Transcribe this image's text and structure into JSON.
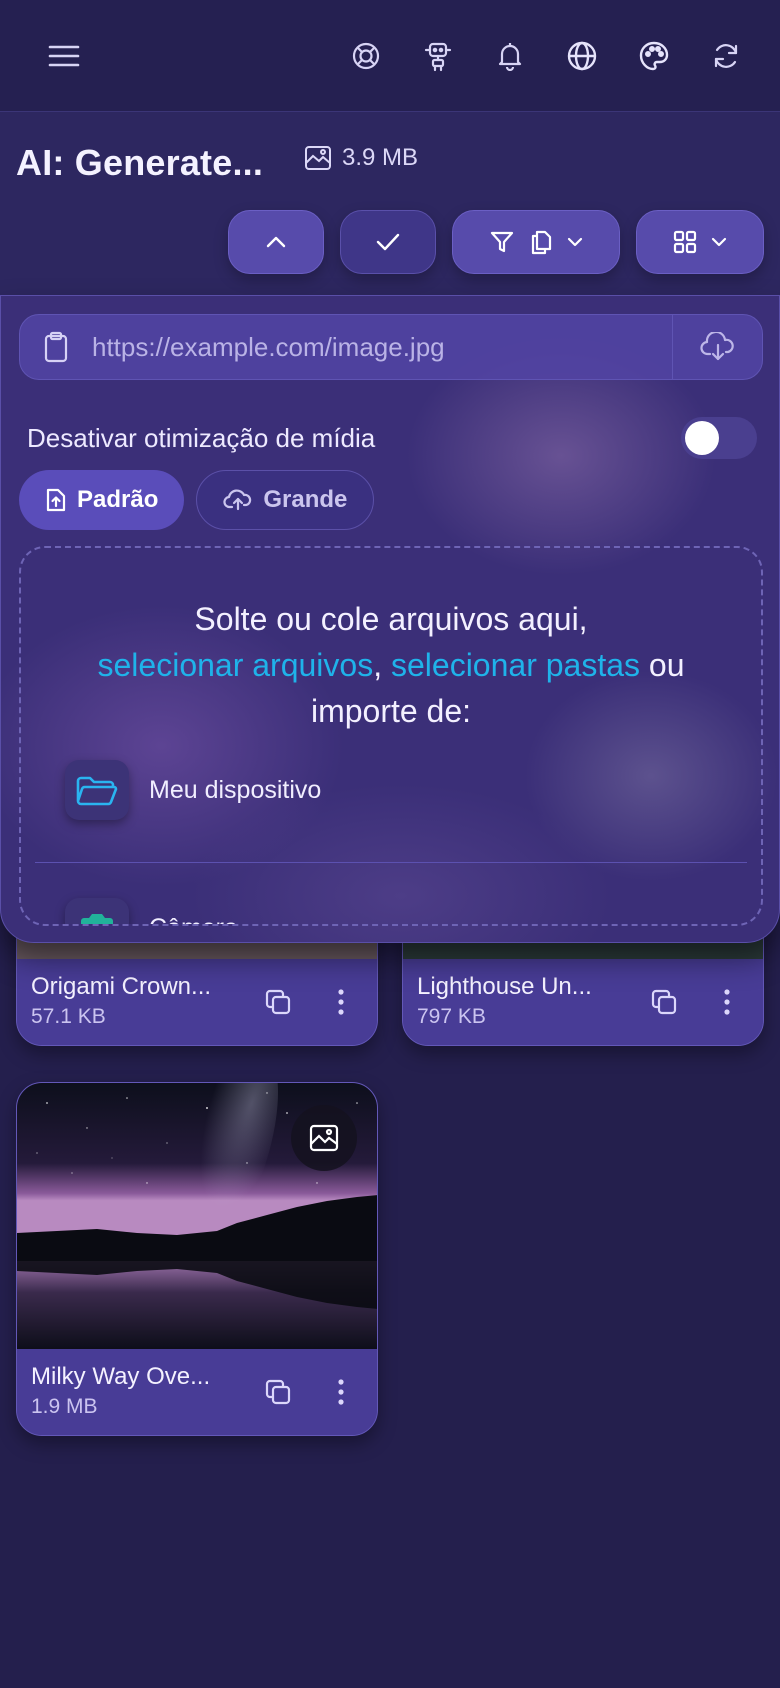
{
  "header": {
    "title": "AI: Generate...",
    "total_size": "3.9 MB"
  },
  "upload": {
    "url_placeholder": "https://example.com/image.jpg",
    "disable_optimization_label": "Desativar otimização de mídia",
    "optimization_disabled": false,
    "modes": [
      {
        "label": "Padrão",
        "active": true
      },
      {
        "label": "Grande",
        "active": false
      }
    ],
    "drop_line1": "Solte ou cole arquivos aqui,",
    "select_files": "selecionar arquivos",
    "comma": ",",
    "select_folders": "selecionar pastas",
    "or_text": "ou",
    "import_from": "importe de:",
    "sources": [
      {
        "label": "Meu dispositivo",
        "icon": "folder-open-icon"
      },
      {
        "label": "Câmera",
        "icon": "camera-icon"
      }
    ]
  },
  "files": [
    {
      "name": "Origami Crown...",
      "size": "57.1 KB"
    },
    {
      "name": "Lighthouse Un...",
      "size": "797 KB"
    },
    {
      "name": "Milky Way Ove...",
      "size": "1.9 MB"
    }
  ],
  "colors": {
    "accent": "#574bab",
    "link": "#1fb3ea",
    "background": "#241f4d"
  }
}
